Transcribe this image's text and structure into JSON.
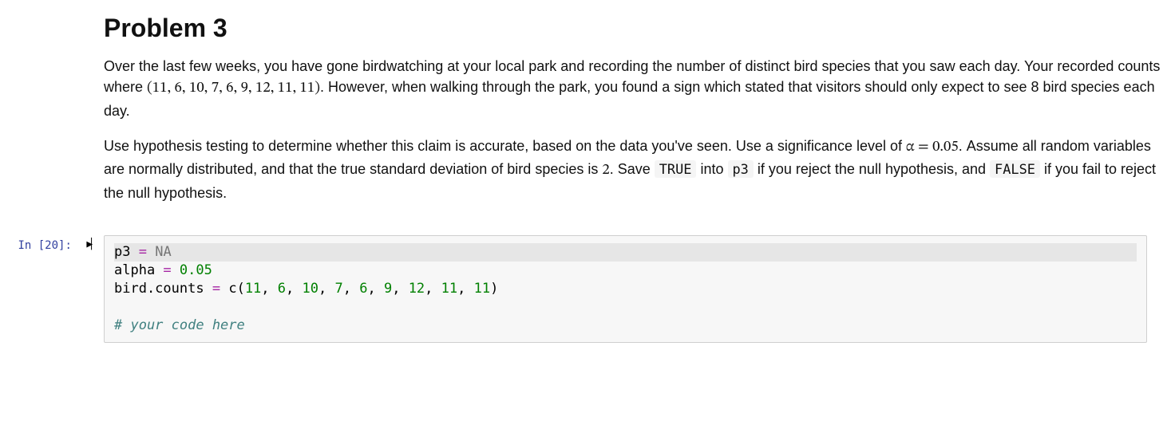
{
  "md": {
    "heading": "Problem 3",
    "p1_a": "Over the last few weeks, you have gone birdwatching at your local park and recording the number of distinct bird species that you saw each day. Your recorded counts where ",
    "p1_counts": "(11, 6, 10, 7, 6, 9, 12, 11, 11)",
    "p1_b": ". However, when walking through the park, you found a sign which stated that visitors should only expect to see 8 bird species each day.",
    "p2_a": "Use hypothesis testing to determine whether this claim is accurate, based on the data you've seen. Use a significance level of ",
    "p2_alpha": "α = 0.05",
    "p2_b": ". Assume all random variables are normally distributed, and that the true standard deviation of bird species is ",
    "p2_sd": "2",
    "p2_c": ". Save ",
    "p2_true": "TRUE",
    "p2_d": " into ",
    "p2_p3": "p3",
    "p2_e": " if you reject the null hypothesis, and ",
    "p2_false": "FALSE",
    "p2_f": " if you fail to reject the null hypothesis."
  },
  "code": {
    "prompt": "In [20]:",
    "l1_var": "p3",
    "l1_eq": " = ",
    "l1_na": "NA",
    "l2_var": "alpha",
    "l2_eq": " = ",
    "l2_num": "0.05",
    "l3_var": "bird.counts",
    "l3_eq1": " = ",
    "l3_fn": "c",
    "l3_op1": "(",
    "l3_n1": "11",
    "l3_c1": ", ",
    "l3_n2": "6",
    "l3_c2": ", ",
    "l3_n3": "10",
    "l3_c3": ", ",
    "l3_n4": "7",
    "l3_c4": ", ",
    "l3_n5": "6",
    "l3_c5": ", ",
    "l3_n6": "9",
    "l3_c6": ", ",
    "l3_n7": "12",
    "l3_c7": ", ",
    "l3_n8": "11",
    "l3_c8": ", ",
    "l3_n9": "11",
    "l3_op2": ")",
    "l5_cmt": "# your code here"
  }
}
